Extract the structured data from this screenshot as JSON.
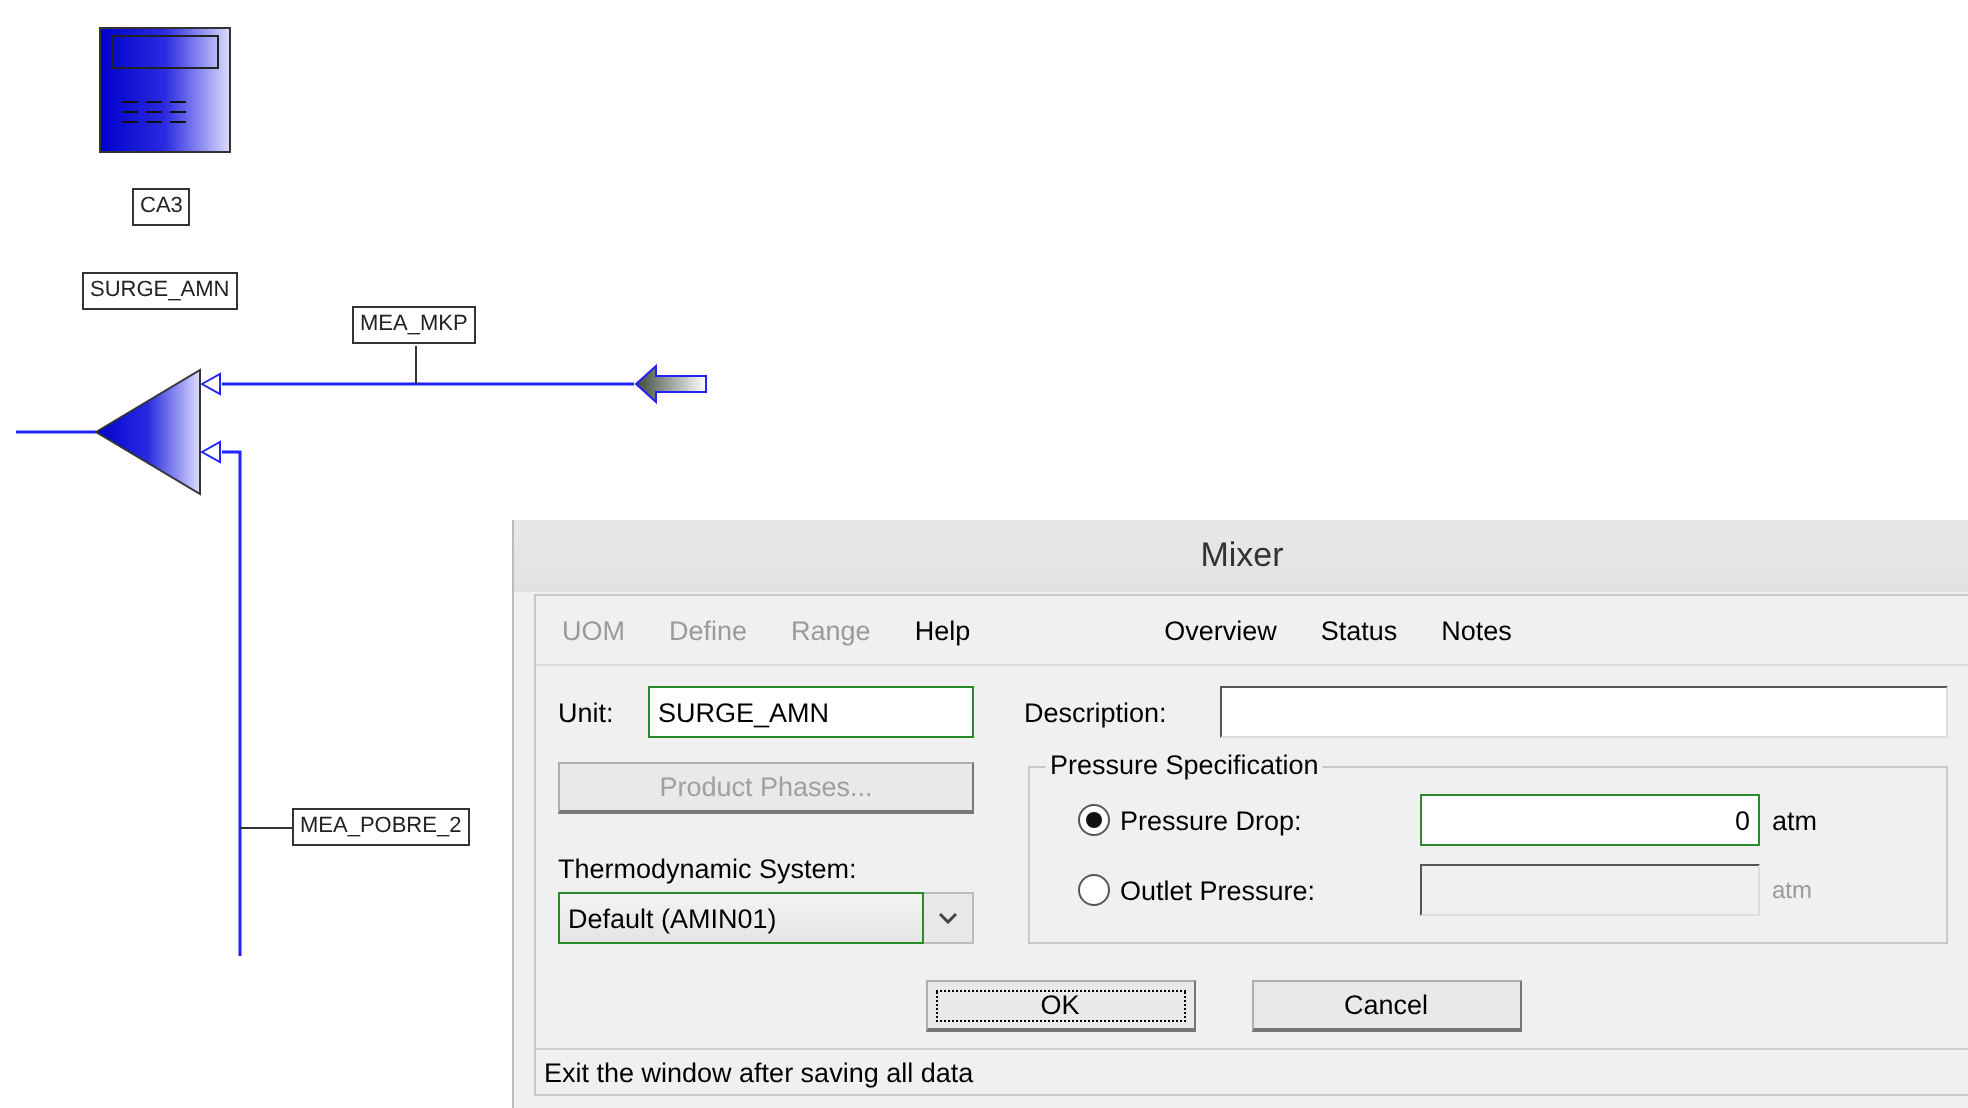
{
  "flowsheet": {
    "equipment_label": "CA3",
    "unit_label": "SURGE_AMN",
    "stream_labels": [
      "MEA_MKP",
      "MEA_POBRE_2"
    ]
  },
  "dialog": {
    "title": "Mixer",
    "menu": [
      {
        "label": "UOM",
        "disabled": true
      },
      {
        "label": "Define",
        "disabled": true
      },
      {
        "label": "Range",
        "disabled": true
      },
      {
        "label": "Help",
        "disabled": false
      }
    ],
    "nav": [
      "Overview",
      "Status",
      "Notes"
    ],
    "unit": {
      "label": "Unit:",
      "value": "SURGE_AMN"
    },
    "description": {
      "label": "Description:"
    },
    "product_phases_button": {
      "label": "Product Phases...",
      "disabled": true
    },
    "thermo": {
      "label": "Thermodynamic System:",
      "value": "Default (AMIN01)"
    },
    "pressure_group": {
      "title": "Pressure Specification",
      "options": [
        {
          "label": "Pressure Drop:",
          "selected": true,
          "value": "0",
          "unit": "atm"
        },
        {
          "label": "Outlet Pressure:",
          "selected": false,
          "unit": "atm"
        }
      ]
    },
    "buttons": [
      {
        "label": "OK",
        "focused": true
      },
      {
        "label": "Cancel",
        "focused": false
      }
    ],
    "status_bar": "Exit the window after saving all data"
  }
}
